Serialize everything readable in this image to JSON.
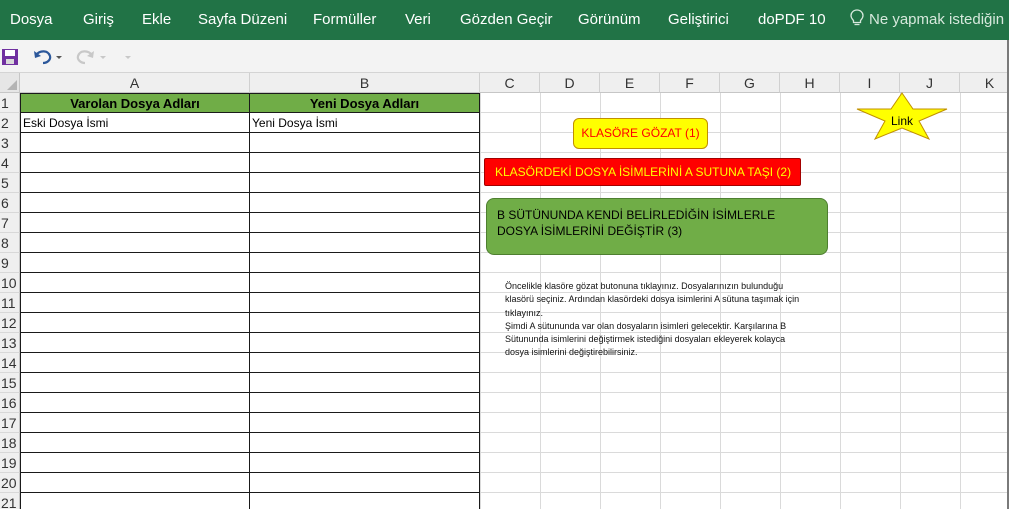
{
  "ribbon": {
    "tabs": [
      "Dosya",
      "Giriş",
      "Ekle",
      "Sayfa Düzeni",
      "Formüller",
      "Veri",
      "Gözden Geçir",
      "Görünüm",
      "Geliştirici",
      "doPDF 10"
    ],
    "tell_me": "Ne yapmak istediğin"
  },
  "columns": [
    "A",
    "B",
    "C",
    "D",
    "E",
    "F",
    "G",
    "H",
    "I",
    "J",
    "K"
  ],
  "rows": [
    "1",
    "2",
    "3",
    "4",
    "5",
    "6",
    "7",
    "8",
    "9",
    "10",
    "11",
    "12",
    "13",
    "14",
    "15",
    "16",
    "17",
    "18",
    "19",
    "20",
    "21"
  ],
  "table": {
    "header_a": "Varolan Dosya Adları",
    "header_b": "Yeni Dosya Adları",
    "a2": "Eski Dosya İsmi",
    "b2": "Yeni Dosya İsmi"
  },
  "buttons": {
    "browse": "KLASÖRE GÖZAT (1)",
    "move_names": "KLASÖRDEKİ DOSYA İSİMLERİNİ A SUTUNA TAŞI (2)",
    "rename": "B SÜTÜNUNDA KENDİ BELİRLEDİĞİN İSİMLERLE  DOSYA İSİMLERİNİ  DEĞİŞTİR (3)",
    "link": "Link"
  },
  "note": "Öncelikle klasöre gözat butonuna tıklayınız. Dosyalarınızın bulunduğu\nklasörü seçiniz. Ardından klasördeki dosya isimlerini A sütuna taşımak için\ntıklayınız.\nŞimdi A sütununda var olan dosyaların isimleri gelecektir. Karşılarına B\nSütununda isimlerini değiştirmek istediğini dosyaları ekleyerek kolayca\ndosya isimlerini değiştirebilirsiniz.",
  "colors": {
    "ribbon": "#217346",
    "header_fill": "#70ad47",
    "yellow": "#ffff00",
    "red": "#ff0000",
    "green": "#70ad47"
  }
}
